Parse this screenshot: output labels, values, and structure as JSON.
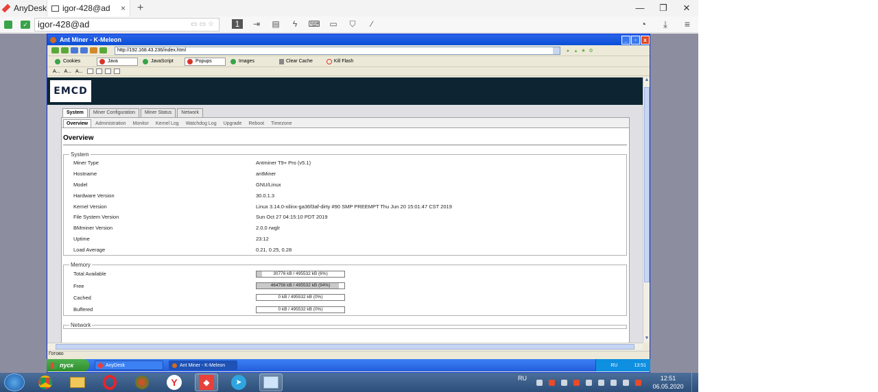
{
  "anydesk": {
    "app_name": "AnyDesk",
    "tab_label": "igor-428@ad",
    "tab_close": "×",
    "new_tab": "+",
    "address_value": "igor-428@ad",
    "window_controls": [
      "—",
      "❐",
      "✕"
    ]
  },
  "browser": {
    "title": "Ant Miner - K-Meleon",
    "url": "http://192.168.43.236/index.html",
    "toolbar2": {
      "cookies": "Cookies",
      "java": "Java",
      "javascript": "JavaScript",
      "popups": "Popups",
      "images": "Images",
      "clear_cache": "Clear Cache",
      "kill_flash": "Kill Flash"
    },
    "toolbar3": [
      "A...",
      "A...",
      "A..."
    ],
    "status": "Готово"
  },
  "page": {
    "logo": "EMCD",
    "main_tabs": [
      "System",
      "Miner Configuration",
      "Miner Status",
      "Network"
    ],
    "sub_tabs": [
      "Overview",
      "Administration",
      "Monitor",
      "Kernel Log",
      "Watchdog Log",
      "Upgrade",
      "Reboot",
      "Timezone"
    ],
    "heading": "Overview",
    "system": {
      "legend": "System",
      "rows": [
        {
          "key": "Miner Type",
          "value": "Antminer T9+ Pro (v5.1)"
        },
        {
          "key": "Hostname",
          "value": "antMiner"
        },
        {
          "key": "Model",
          "value": "GNU/Linux"
        },
        {
          "key": "Hardware Version",
          "value": "30.0.1.3"
        },
        {
          "key": "Kernel Version",
          "value": "Linux 3.14.0-xilinx-ga36f3af-dirty #90 SMP PREEMPT Thu Jun 20 15:01:47 CST 2019"
        },
        {
          "key": "File System Version",
          "value": "Sun Oct 27 04:15:10 PDT 2019"
        },
        {
          "key": "BMminer Version",
          "value": "2.0.0 rwglr"
        },
        {
          "key": "Uptime",
          "value": "23:12"
        },
        {
          "key": "Load Average",
          "value": "0.21, 0.25, 0.28"
        }
      ]
    },
    "memory": {
      "legend": "Memory",
      "rows": [
        {
          "key": "Total Available",
          "text": "30776 kB / 495532 kB (6%)",
          "fraction": 0.06
        },
        {
          "key": "Free",
          "text": "464756 kB / 495532 kB (94%)",
          "fraction": 0.94
        },
        {
          "key": "Cached",
          "text": "0 kB / 495532 kB (0%)",
          "fraction": 0
        },
        {
          "key": "Buffered",
          "text": "0 kB / 495532 kB (0%)",
          "fraction": 0
        }
      ]
    },
    "network_legend": "Network"
  },
  "xp_taskbar": {
    "start": "пуск",
    "tasks": [
      "AnyDesk",
      "Ant Miner - K-Meleon"
    ],
    "tray_lang": "RU",
    "tray_time": "13:51"
  },
  "win7": {
    "lang": "RU",
    "time": "12:51",
    "date": "06.05.2020"
  },
  "colors": {
    "header_bg": "#0d2533",
    "xp_blue": "#245edb",
    "anydesk_red": "#e8413a"
  }
}
